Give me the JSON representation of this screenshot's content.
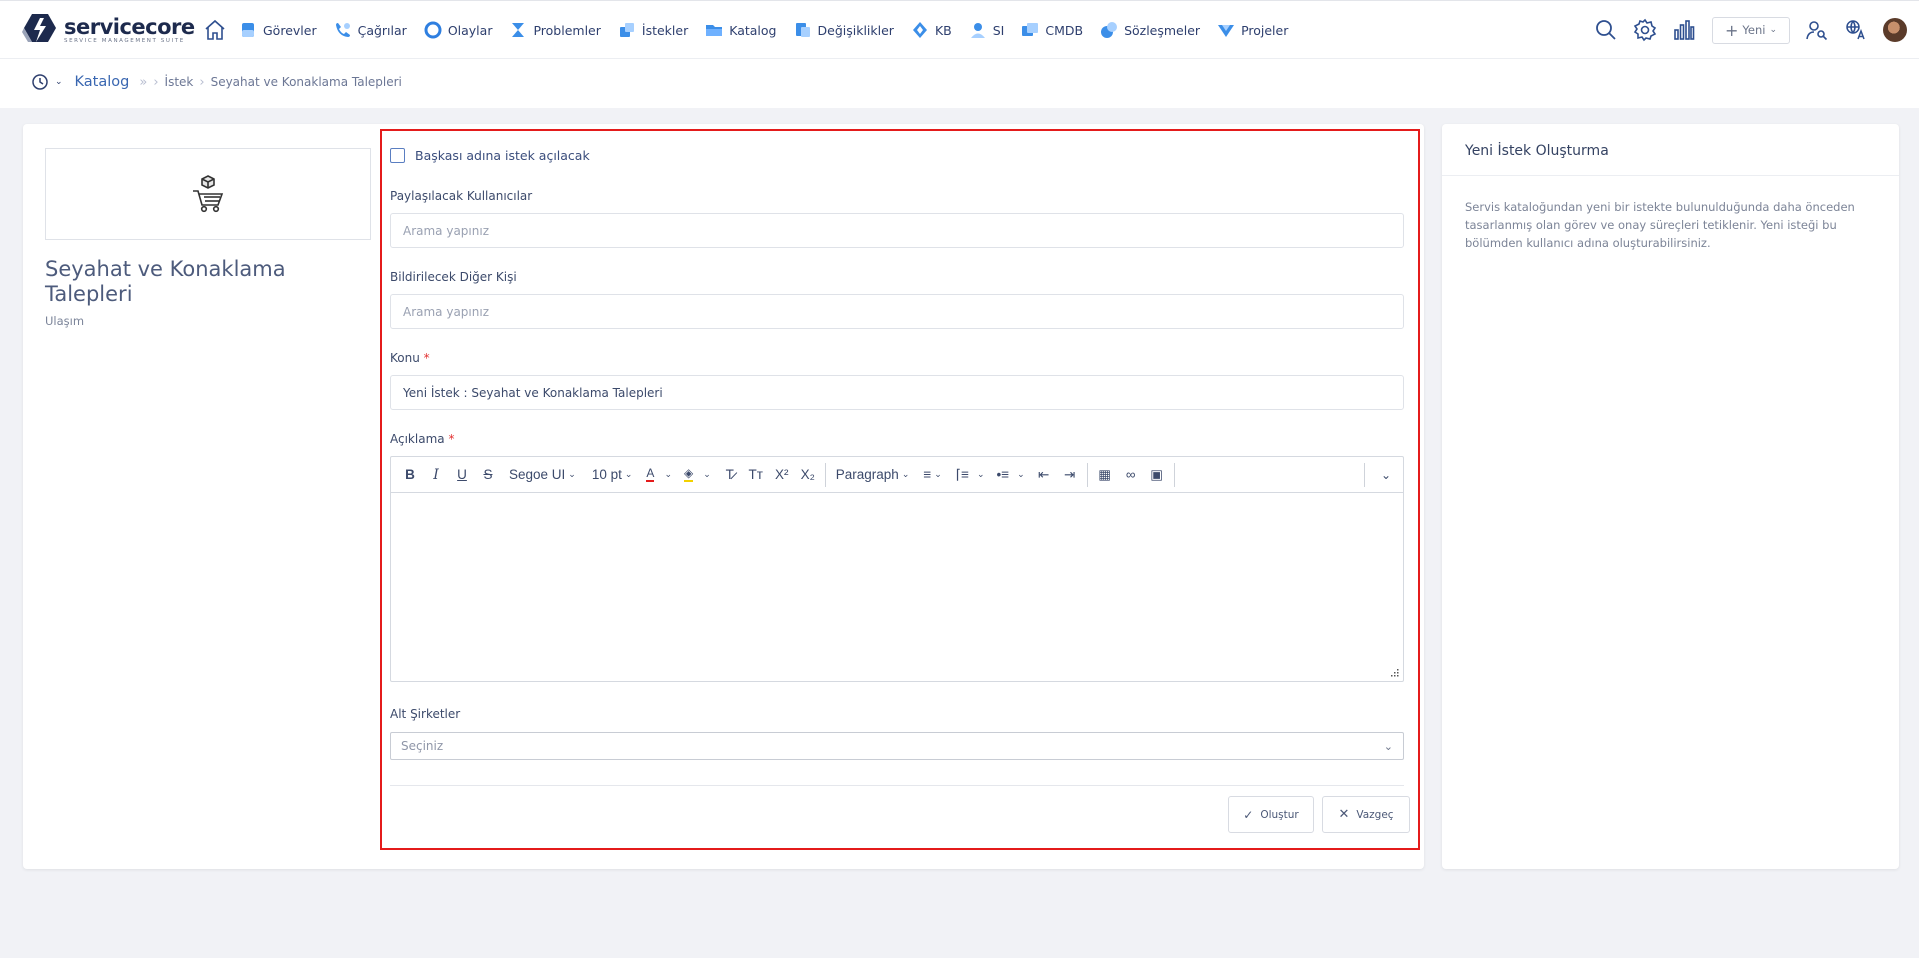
{
  "brand": {
    "name": "servicecore",
    "tagline": "SERVICE MANAGEMENT SUITE"
  },
  "nav": {
    "items": [
      {
        "label": "Görevler",
        "icon": "tasks-icon",
        "color": "#3b8ee8"
      },
      {
        "label": "Çağrılar",
        "icon": "calls-icon",
        "color": "#3b8ee8"
      },
      {
        "label": "Olaylar",
        "icon": "incidents-icon",
        "color": "#2f7fe0"
      },
      {
        "label": "Problemler",
        "icon": "problems-icon",
        "color": "#3b8ee8"
      },
      {
        "label": "İstekler",
        "icon": "requests-icon",
        "color": "#3b8ee8"
      },
      {
        "label": "Katalog",
        "icon": "catalog-icon",
        "color": "#3b8ee8"
      },
      {
        "label": "Değişiklikler",
        "icon": "changes-icon",
        "color": "#3b8ee8"
      },
      {
        "label": "KB",
        "icon": "kb-icon",
        "color": "#3b8ee8"
      },
      {
        "label": "SI",
        "icon": "si-icon",
        "color": "#3b8ee8"
      },
      {
        "label": "CMDB",
        "icon": "cmdb-icon",
        "color": "#3b8ee8"
      },
      {
        "label": "Sözleşmeler",
        "icon": "contracts-icon",
        "color": "#3b8ee8"
      },
      {
        "label": "Projeler",
        "icon": "projects-icon",
        "color": "#3b8ee8"
      }
    ],
    "new_label": "Yeni"
  },
  "breadcrumb": {
    "root": "Katalog",
    "path": "İstek",
    "current": "Seyahat ve Konaklama Talepleri"
  },
  "service": {
    "title": "Seyahat ve Konaklama Talepleri",
    "category": "Ulaşım"
  },
  "form": {
    "on_behalf_label": "Başkası adına istek açılacak",
    "share_users_label": "Paylaşılacak Kullanıcılar",
    "share_users_placeholder": "Arama yapınız",
    "notify_label": "Bildirilecek Diğer Kişi",
    "notify_placeholder": "Arama yapınız",
    "subject_label": "Konu",
    "subject_value": "Yeni İstek : Seyahat ve Konaklama Talepleri",
    "description_label": "Açıklama",
    "required_mark": "*",
    "editor": {
      "font": "Segoe UI",
      "size": "10 pt",
      "block": "Paragraph"
    },
    "subcompanies_label": "Alt Şirketler",
    "subcompanies_placeholder": "Seçiniz",
    "create_label": "Oluştur",
    "cancel_label": "Vazgeç"
  },
  "info": {
    "title": "Yeni İstek Oluşturma",
    "text": "Servis kataloğundan yeni bir istekte bulunulduğunda daha önceden tasarlanmış olan görev ve onay süreçleri tetiklenir. Yeni isteği bu bölümden kullanıcı adına oluşturabilirsiniz."
  },
  "colors": {
    "accent": "#3a67b1",
    "highlight": "#e41b1b",
    "brand_dark": "#1d2a4d"
  }
}
